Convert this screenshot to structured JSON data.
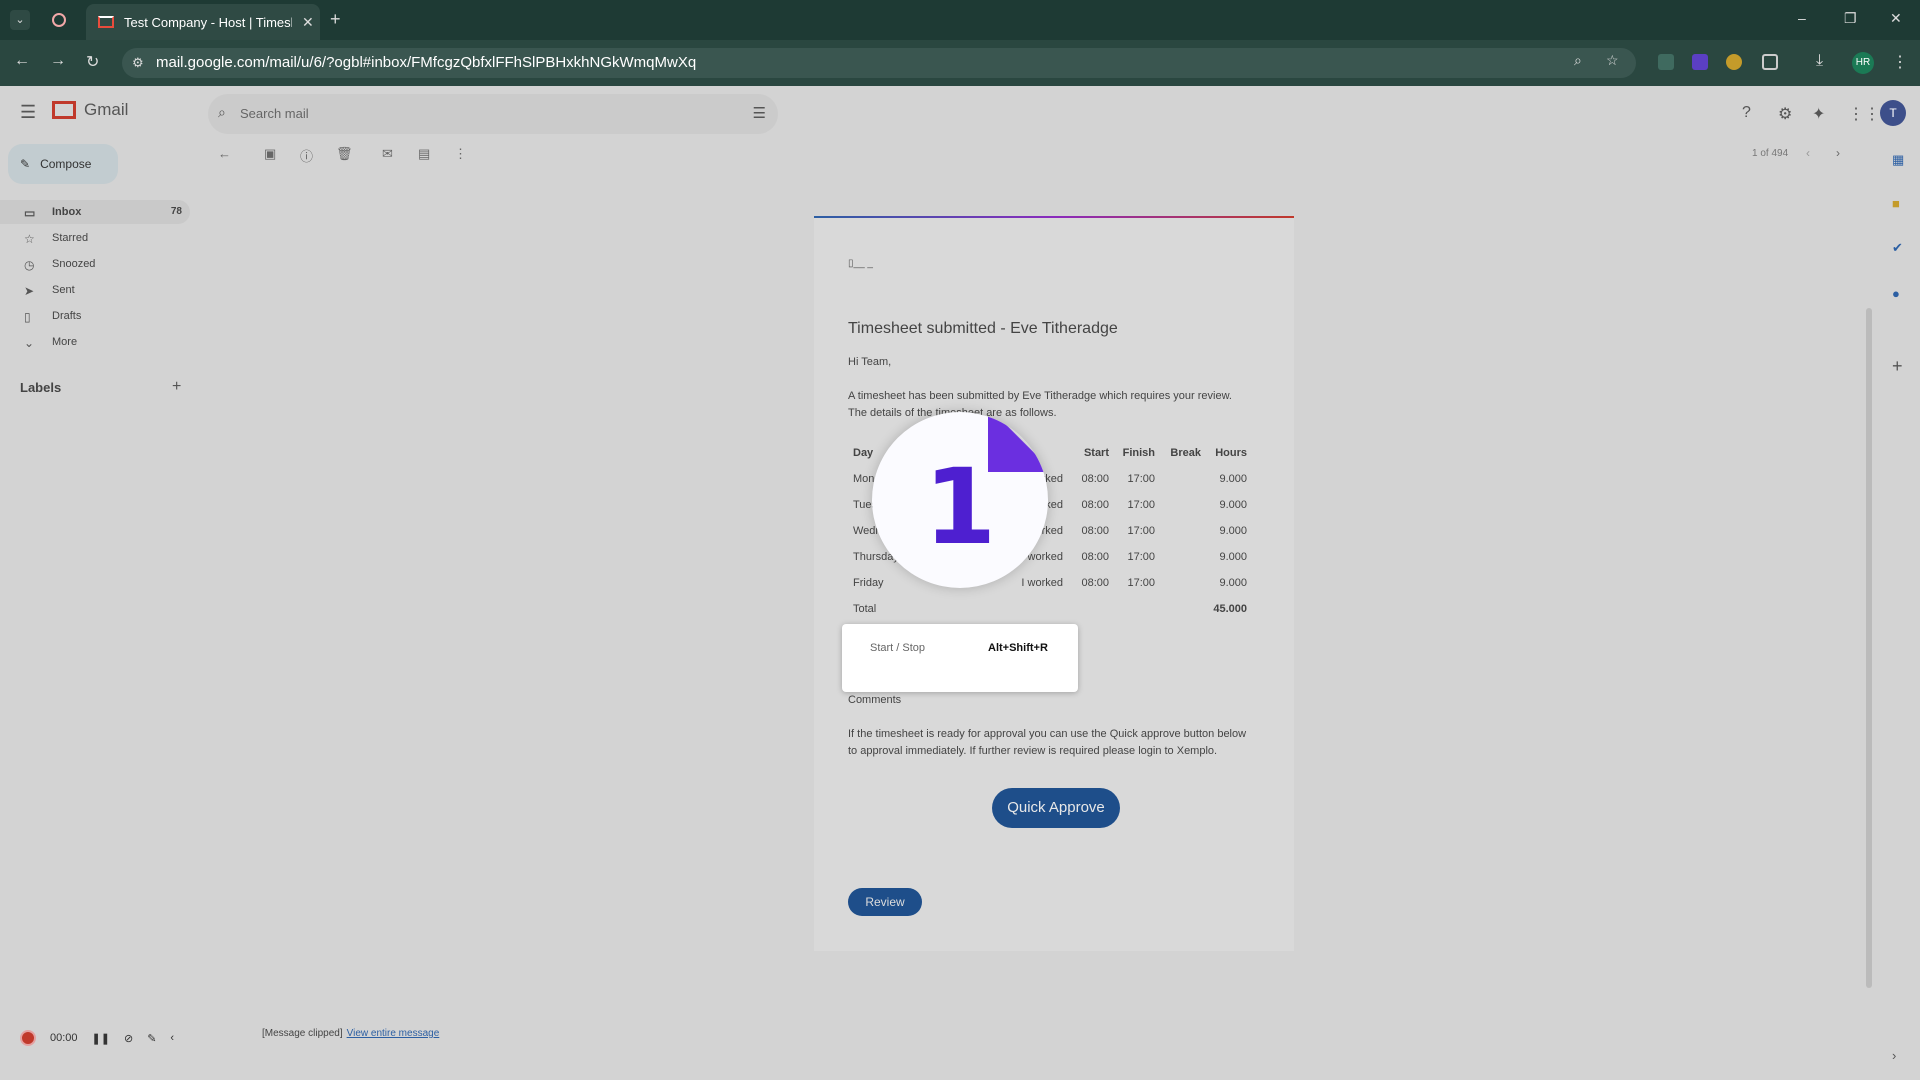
{
  "browser": {
    "tab_title": "Test Company - Host | Timeshe",
    "new_tab": "+",
    "url": "mail.google.com/mail/u/6/?ogbl#inbox/FMfcgzQbfxlFFhSlPBHxkhNGkWmqMwXq",
    "profile": "HR",
    "window_controls": [
      "–",
      "❐",
      "✕"
    ]
  },
  "gmail": {
    "brand": "Gmail",
    "search_placeholder": "Search mail",
    "avatar": "T",
    "compose": "Compose",
    "nav": [
      {
        "label": "Inbox",
        "count": "78",
        "icon": "inbox-icon"
      },
      {
        "label": "Starred",
        "count": "",
        "icon": "star-icon"
      },
      {
        "label": "Snoozed",
        "count": "",
        "icon": "clock-icon"
      },
      {
        "label": "Sent",
        "count": "",
        "icon": "send-icon"
      },
      {
        "label": "Drafts",
        "count": "",
        "icon": "draft-icon"
      },
      {
        "label": "More",
        "count": "",
        "icon": "chevron-down-icon"
      }
    ],
    "labels_heading": "Labels",
    "pager": "1 of 494"
  },
  "email": {
    "title": "Timesheet submitted - Eve Titheradge",
    "greeting": "Hi Team,",
    "intro1": "A timesheet has been submitted by Eve Titheradge which requires your review.",
    "intro2": "The details of the timesheet are as follows.",
    "table": {
      "headers": [
        "Day",
        "",
        "Start",
        "Finish",
        "Break",
        "Hours"
      ],
      "rows": [
        [
          "Monday",
          "I worked",
          "08:00",
          "17:00",
          "",
          "9.000"
        ],
        [
          "Tuesday",
          "I worked",
          "08:00",
          "17:00",
          "",
          "9.000"
        ],
        [
          "Wednesday",
          "I worked",
          "08:00",
          "17:00",
          "",
          "9.000"
        ],
        [
          "Thursday",
          "I worked",
          "08:00",
          "17:00",
          "",
          "9.000"
        ],
        [
          "Friday",
          "I worked",
          "08:00",
          "17:00",
          "",
          "9.000"
        ]
      ],
      "total_label": "Total",
      "total_value": "45.000"
    },
    "comments_label": "Comments",
    "approve_text1": "If the timesheet is ready for approval you can use the Quick approve button below",
    "approve_text2": "to approval immediately. If further review is required please login to Xemplo.",
    "quick_approve": "Quick Approve",
    "review": "Review",
    "clipped": "[Message clipped]",
    "view_entire": "View entire message"
  },
  "overlay": {
    "badge_number": "1",
    "tooltip_action": "Start / Stop",
    "tooltip_shortcut": "Alt+Shift+R"
  },
  "recorder": {
    "time": "00:00"
  }
}
